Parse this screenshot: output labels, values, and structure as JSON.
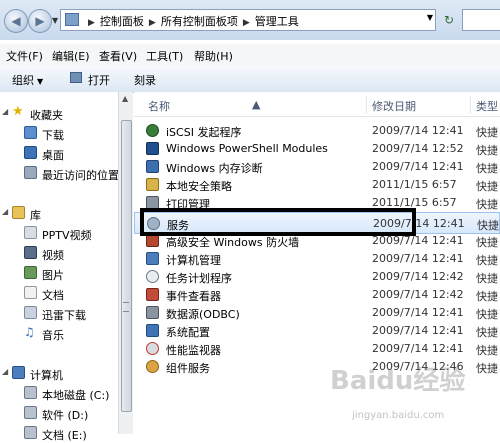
{
  "address": {
    "crumbs": [
      "控制面板",
      "所有控制面板项",
      "管理工具"
    ]
  },
  "menu": [
    "文件(F)",
    "编辑(E)",
    "查看(V)",
    "工具(T)",
    "帮助(H)"
  ],
  "toolbar": {
    "organize": "组织",
    "open": "打开",
    "burn": "刻录"
  },
  "nav": {
    "favorites": "收藏夹",
    "fav_items": [
      "下载",
      "桌面",
      "最近访问的位置"
    ],
    "libraries": "库",
    "lib_items": [
      "PPTV视频",
      "视频",
      "图片",
      "文档",
      "迅雷下载",
      "音乐"
    ],
    "computer": "计算机",
    "comp_items": [
      "本地磁盘 (C:)",
      "软件 (D:)",
      "文档 (E:)"
    ]
  },
  "columns": {
    "name": "名称",
    "modified": "修改日期",
    "type": "类型"
  },
  "files": [
    {
      "name": "iSCSI 发起程序",
      "date": "2009/7/14 12:41",
      "type": "快捷"
    },
    {
      "name": "Windows PowerShell Modules",
      "date": "2009/7/14 12:52",
      "type": "快捷"
    },
    {
      "name": "Windows 内存诊断",
      "date": "2009/7/14 12:41",
      "type": "快捷"
    },
    {
      "name": "本地安全策略",
      "date": "2011/1/15 6:57",
      "type": "快捷"
    },
    {
      "name": "打印管理",
      "date": "2011/1/15 6:57",
      "type": "快捷"
    },
    {
      "name": "服务",
      "date": "2009/7/14 12:41",
      "type": "快捷"
    },
    {
      "name": "高级安全 Windows 防火墙",
      "date": "2009/7/14 12:41",
      "type": "快捷"
    },
    {
      "name": "计算机管理",
      "date": "2009/7/14 12:41",
      "type": "快捷"
    },
    {
      "name": "任务计划程序",
      "date": "2009/7/14 12:42",
      "type": "快捷"
    },
    {
      "name": "事件查看器",
      "date": "2009/7/14 12:42",
      "type": "快捷"
    },
    {
      "name": "数据源(ODBC)",
      "date": "2009/7/14 12:41",
      "type": "快捷"
    },
    {
      "name": "系统配置",
      "date": "2009/7/14 12:41",
      "type": "快捷"
    },
    {
      "name": "性能监视器",
      "date": "2009/7/14 12:41",
      "type": "快捷"
    },
    {
      "name": "组件服务",
      "date": "2009/7/14 12:46",
      "type": "快捷"
    }
  ],
  "selected_index": 5,
  "watermark": {
    "logo": "Baidu经验",
    "url": "jingyan.baidu.com"
  }
}
